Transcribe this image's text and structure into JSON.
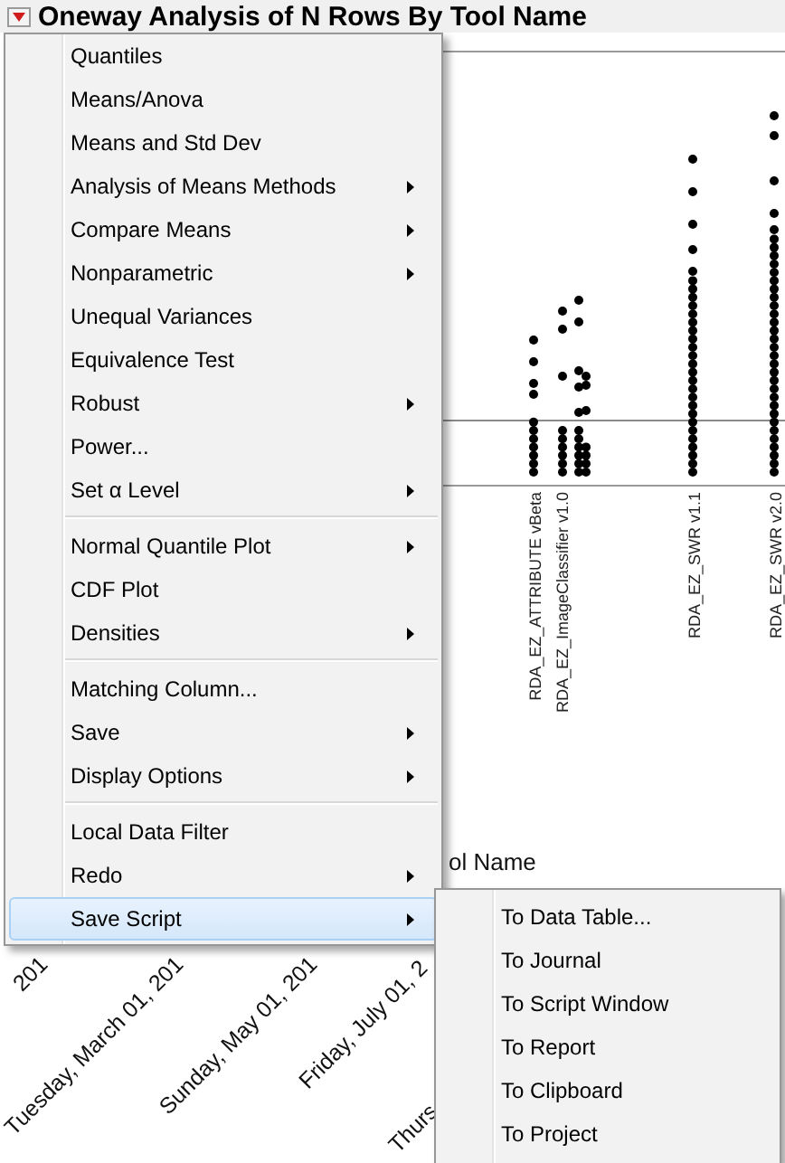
{
  "title": "Oneway Analysis of N Rows By Tool Name",
  "plot": {
    "group_labels": [
      {
        "label": "RDA_EZ_ATTRIBUTE vBeta"
      },
      {
        "label": "RDA_EZ_ImageClassifier v1.0"
      },
      {
        "label": "RDA_EZ_SWR v1.1"
      },
      {
        "label": "RDA_EZ_SWR v2.0"
      }
    ],
    "axis_title": "ol Name",
    "date_labels": [
      "201",
      "Tuesday, March 01, 201",
      "Sunday, May 01, 201",
      "Friday, July 01, 2",
      "Thurs"
    ]
  },
  "menu": {
    "items": [
      {
        "kind": "item",
        "label": "Quantiles",
        "submenu": false,
        "selected": false
      },
      {
        "kind": "item",
        "label": "Means/Anova",
        "submenu": false,
        "selected": false
      },
      {
        "kind": "item",
        "label": "Means and Std Dev",
        "submenu": false,
        "selected": false
      },
      {
        "kind": "item",
        "label": "Analysis of Means Methods",
        "submenu": true,
        "selected": false
      },
      {
        "kind": "item",
        "label": "Compare Means",
        "submenu": true,
        "selected": false
      },
      {
        "kind": "item",
        "label": "Nonparametric",
        "submenu": true,
        "selected": false
      },
      {
        "kind": "item",
        "label": "Unequal Variances",
        "submenu": false,
        "selected": false
      },
      {
        "kind": "item",
        "label": "Equivalence Test",
        "submenu": false,
        "selected": false
      },
      {
        "kind": "item",
        "label": "Robust",
        "submenu": true,
        "selected": false
      },
      {
        "kind": "item",
        "label": "Power...",
        "submenu": false,
        "selected": false
      },
      {
        "kind": "item",
        "label": "Set α Level",
        "submenu": true,
        "selected": false
      },
      {
        "kind": "separator"
      },
      {
        "kind": "item",
        "label": "Normal Quantile Plot",
        "submenu": true,
        "selected": false
      },
      {
        "kind": "item",
        "label": "CDF Plot",
        "submenu": false,
        "selected": false
      },
      {
        "kind": "item",
        "label": "Densities",
        "submenu": true,
        "selected": false
      },
      {
        "kind": "separator"
      },
      {
        "kind": "item",
        "label": "Matching Column...",
        "submenu": false,
        "selected": false
      },
      {
        "kind": "item",
        "label": "Save",
        "submenu": true,
        "selected": false
      },
      {
        "kind": "item",
        "label": "Display Options",
        "submenu": true,
        "selected": false
      },
      {
        "kind": "separator"
      },
      {
        "kind": "item",
        "label": "Local Data Filter",
        "submenu": false,
        "selected": false
      },
      {
        "kind": "item",
        "label": "Redo",
        "submenu": true,
        "selected": false
      },
      {
        "kind": "item",
        "label": "Save Script",
        "submenu": true,
        "selected": true
      }
    ]
  },
  "submenu": {
    "items": [
      {
        "label": "To Data Table..."
      },
      {
        "label": "To Journal"
      },
      {
        "label": "To Script Window"
      },
      {
        "label": "To Report"
      },
      {
        "label": "To Clipboard"
      },
      {
        "label": "To Project"
      }
    ]
  }
}
